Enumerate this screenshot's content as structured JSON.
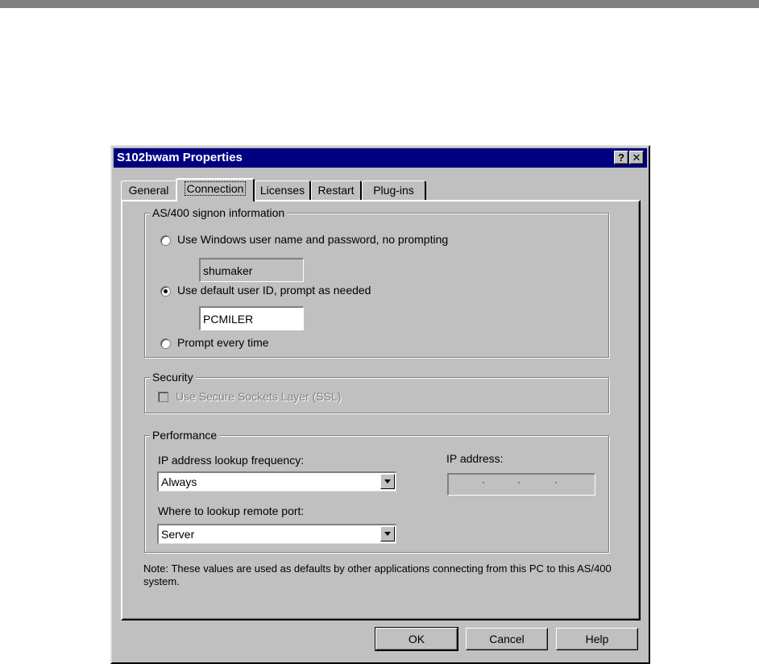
{
  "window": {
    "title": "S102bwam Properties",
    "help_button": "?",
    "close_button": "✕"
  },
  "tabs": [
    {
      "label": "General",
      "active": false
    },
    {
      "label": "Connection",
      "active": true
    },
    {
      "label": "Licenses",
      "active": false
    },
    {
      "label": "Restart",
      "active": false
    },
    {
      "label": "Plug-ins",
      "active": false
    }
  ],
  "signon": {
    "legend": "AS/400 signon information",
    "option_windows": "Use Windows user name and password, no prompting",
    "windows_user_value": "shumaker",
    "option_default": "Use default user ID, prompt as needed",
    "default_user_value": "PCMILER",
    "option_prompt": "Prompt every time",
    "selected": "default"
  },
  "security": {
    "legend": "Security",
    "ssl_label": "Use Secure Sockets Layer (SSL)",
    "ssl_checked": false,
    "ssl_enabled": false
  },
  "performance": {
    "legend": "Performance",
    "lookup_label": "IP address lookup frequency:",
    "lookup_value": "Always",
    "ip_label": "IP address:",
    "remote_port_label": "Where to lookup remote port:",
    "remote_port_value": "Server"
  },
  "note": "Note: These values are used as defaults by other applications connecting from this PC to this AS/400 system.",
  "buttons": {
    "ok": "OK",
    "cancel": "Cancel",
    "help": "Help"
  }
}
